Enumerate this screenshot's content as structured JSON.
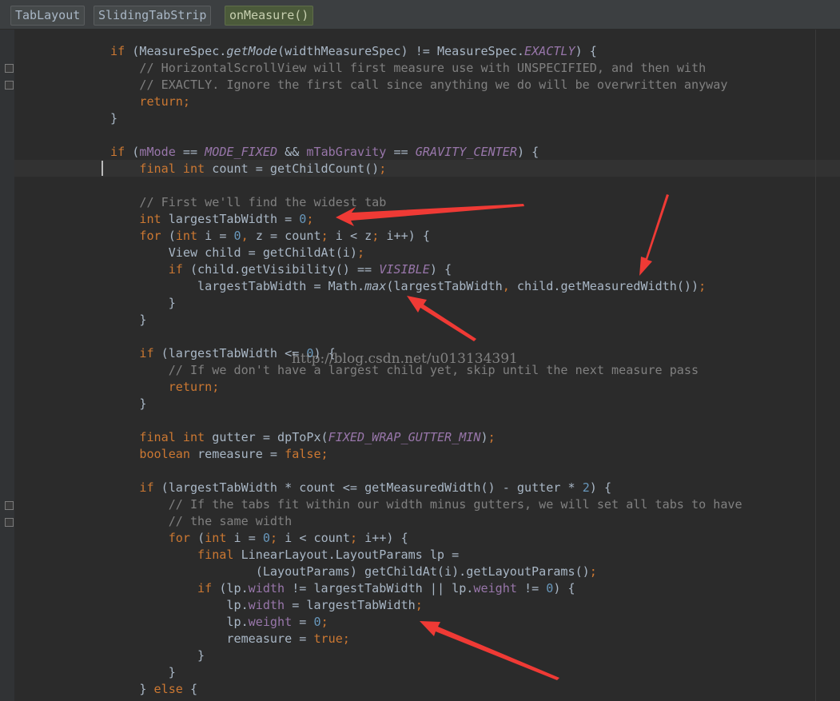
{
  "breadcrumb": {
    "items": [
      "TabLayout",
      "SlidingTabStrip",
      "onMeasure()"
    ]
  },
  "watermark": "http://blog.csdn.net/u013134391",
  "code_lines": [
    [
      [
        "kw",
        "if "
      ],
      [
        "",
        "(MeasureSpec."
      ],
      [
        "sm",
        "getMode"
      ],
      [
        "",
        "(widthMeasureSpec) != MeasureSpec."
      ],
      [
        "ist",
        "EXACTLY"
      ],
      [
        "",
        ") {"
      ]
    ],
    [
      [
        "",
        "    "
      ],
      [
        "cm",
        "// HorizontalScrollView will first measure use with UNSPECIFIED, and then with"
      ]
    ],
    [
      [
        "",
        "    "
      ],
      [
        "cm",
        "// EXACTLY. Ignore the first call since anything we do will be overwritten anyway"
      ]
    ],
    [
      [
        "",
        "    "
      ],
      [
        "kw",
        "return;"
      ]
    ],
    [
      [
        "",
        "}"
      ]
    ],
    [],
    [
      [
        "kw",
        "if "
      ],
      [
        "",
        "("
      ],
      [
        "fld",
        "mMode"
      ],
      [
        "",
        " == "
      ],
      [
        "ist",
        "MODE_FIXED"
      ],
      [
        "",
        " && "
      ],
      [
        "fld",
        "mTabGravity"
      ],
      [
        "",
        " == "
      ],
      [
        "ist",
        "GRAVITY_CENTER"
      ],
      [
        "",
        ") {"
      ]
    ],
    [
      [
        "",
        "    "
      ],
      [
        "kw",
        "final int "
      ],
      [
        "",
        "count = getChildCount()"
      ],
      [
        "kw",
        ";"
      ]
    ],
    [],
    [
      [
        "",
        "    "
      ],
      [
        "cm",
        "// First we'll find the widest tab"
      ]
    ],
    [
      [
        "",
        "    "
      ],
      [
        "kw",
        "int "
      ],
      [
        "",
        "largestTabWidth = "
      ],
      [
        "num",
        "0"
      ],
      [
        "kw",
        ";"
      ]
    ],
    [
      [
        "",
        "    "
      ],
      [
        "kw",
        "for "
      ],
      [
        "",
        "("
      ],
      [
        "kw",
        "int "
      ],
      [
        "",
        "i = "
      ],
      [
        "num",
        "0"
      ],
      [
        "kw",
        ", "
      ],
      [
        "",
        "z = count"
      ],
      [
        "kw",
        "; "
      ],
      [
        "",
        "i < z"
      ],
      [
        "kw",
        "; "
      ],
      [
        "",
        "i++) {"
      ]
    ],
    [
      [
        "",
        "        View child = getChildAt(i)"
      ],
      [
        "kw",
        ";"
      ]
    ],
    [
      [
        "",
        "        "
      ],
      [
        "kw",
        "if "
      ],
      [
        "",
        "(child.getVisibility() == "
      ],
      [
        "ist",
        "VISIBLE"
      ],
      [
        "",
        ") {"
      ]
    ],
    [
      [
        "",
        "            largestTabWidth = Math."
      ],
      [
        "sm",
        "max"
      ],
      [
        "",
        "(largestTabWidth"
      ],
      [
        "kw",
        ", "
      ],
      [
        "",
        "child.getMeasuredWidth())"
      ],
      [
        "kw",
        ";"
      ]
    ],
    [
      [
        "",
        "        }"
      ]
    ],
    [
      [
        "",
        "    }"
      ]
    ],
    [],
    [
      [
        "",
        "    "
      ],
      [
        "kw",
        "if "
      ],
      [
        "",
        "(largestTabWidth <= "
      ],
      [
        "num",
        "0"
      ],
      [
        "",
        ") {"
      ]
    ],
    [
      [
        "",
        "        "
      ],
      [
        "cm",
        "// If we don't have a largest child yet, skip until the next measure pass"
      ]
    ],
    [
      [
        "",
        "        "
      ],
      [
        "kw",
        "return;"
      ]
    ],
    [
      [
        "",
        "    }"
      ]
    ],
    [],
    [
      [
        "",
        "    "
      ],
      [
        "kw",
        "final int "
      ],
      [
        "",
        "gutter = dpToPx("
      ],
      [
        "ist",
        "FIXED_WRAP_GUTTER_MIN"
      ],
      [
        "",
        ")"
      ],
      [
        "kw",
        ";"
      ]
    ],
    [
      [
        "",
        "    "
      ],
      [
        "kw",
        "boolean "
      ],
      [
        "",
        "remeasure = "
      ],
      [
        "kw",
        "false;"
      ]
    ],
    [],
    [
      [
        "",
        "    "
      ],
      [
        "kw",
        "if "
      ],
      [
        "",
        "(largestTabWidth * count <= getMeasuredWidth() - gutter * "
      ],
      [
        "num",
        "2"
      ],
      [
        "",
        ") {"
      ]
    ],
    [
      [
        "",
        "        "
      ],
      [
        "cm",
        "// If the tabs fit within our width minus gutters, we will set all tabs to have"
      ]
    ],
    [
      [
        "",
        "        "
      ],
      [
        "cm",
        "// the same width"
      ]
    ],
    [
      [
        "",
        "        "
      ],
      [
        "kw",
        "for "
      ],
      [
        "",
        "("
      ],
      [
        "kw",
        "int "
      ],
      [
        "",
        "i = "
      ],
      [
        "num",
        "0"
      ],
      [
        "kw",
        "; "
      ],
      [
        "",
        "i < count"
      ],
      [
        "kw",
        "; "
      ],
      [
        "",
        "i++) {"
      ]
    ],
    [
      [
        "",
        "            "
      ],
      [
        "kw",
        "final "
      ],
      [
        "",
        "LinearLayout.LayoutParams lp ="
      ]
    ],
    [
      [
        "",
        "                    (LayoutParams) getChildAt(i).getLayoutParams()"
      ],
      [
        "kw",
        ";"
      ]
    ],
    [
      [
        "",
        "            "
      ],
      [
        "kw",
        "if "
      ],
      [
        "",
        "(lp."
      ],
      [
        "fld",
        "width"
      ],
      [
        "",
        " != largestTabWidth || lp."
      ],
      [
        "fld",
        "weight"
      ],
      [
        "",
        " != "
      ],
      [
        "num",
        "0"
      ],
      [
        "",
        ") {"
      ]
    ],
    [
      [
        "",
        "                lp."
      ],
      [
        "fld",
        "width"
      ],
      [
        "",
        " = largestTabWidth"
      ],
      [
        "kw",
        ";"
      ]
    ],
    [
      [
        "",
        "                lp."
      ],
      [
        "fld",
        "weight"
      ],
      [
        "",
        " = "
      ],
      [
        "num",
        "0"
      ],
      [
        "kw",
        ";"
      ]
    ],
    [
      [
        "",
        "                remeasure = "
      ],
      [
        "kw",
        "true;"
      ]
    ],
    [
      [
        "",
        "            }"
      ]
    ],
    [
      [
        "",
        "        }"
      ]
    ],
    [
      [
        "",
        "    } "
      ],
      [
        "kw",
        "else "
      ],
      [
        "",
        "{"
      ]
    ]
  ],
  "colors": {
    "background": "#2b2b2b",
    "keyword": "#cc7832",
    "comment": "#808080",
    "number": "#6897bb",
    "field": "#9876aa",
    "text": "#a9b7c6",
    "arrow": "#ef3a35"
  }
}
